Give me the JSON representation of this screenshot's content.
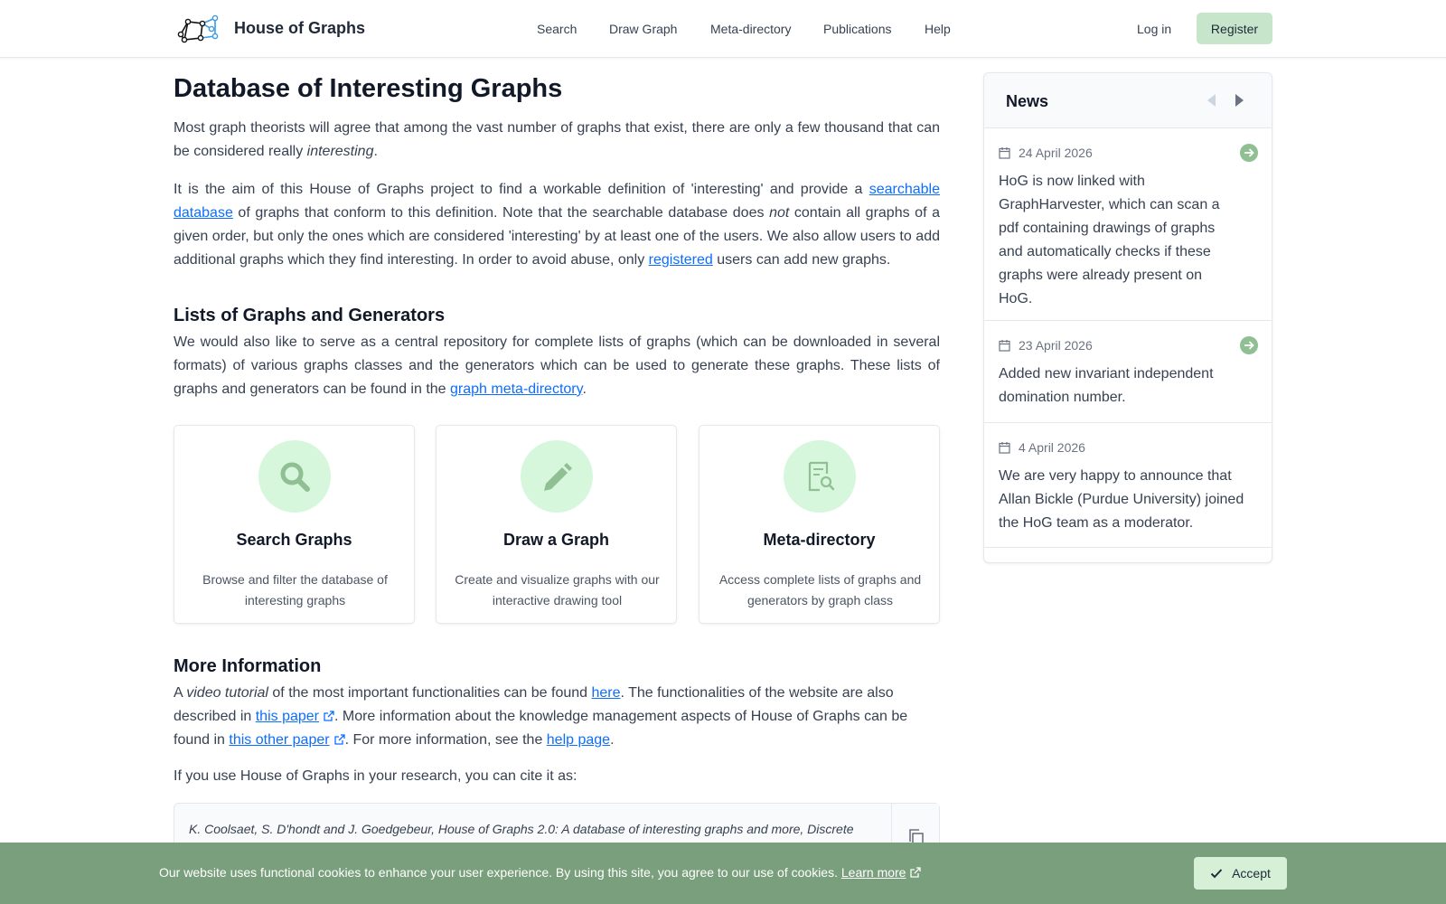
{
  "header": {
    "brand": "House of Graphs",
    "nav": [
      "Search",
      "Draw Graph",
      "Meta-directory",
      "Publications",
      "Help"
    ],
    "login": "Log in",
    "register": "Register"
  },
  "main": {
    "title": "Database of Interesting Graphs",
    "intro": {
      "p1_a": "Most graph theorists will agree that among the vast number of graphs that exist, there are only a few thousand that can be considered really ",
      "p1_em": "interesting",
      "p1_b": ".",
      "p2_a": "It is the aim of this House of Graphs project to find a workable definition of 'interesting' and provide a ",
      "p2_link": "searchable database",
      "p2_b": " of graphs that conform to this definition. Note that the searchable database does ",
      "p2_em": "not",
      "p2_c": " contain all graphs of a given order, but only the ones which are considered 'interesting' by at least one of the users. We also allow users to add additional graphs which they find interesting. In order to avoid abuse, only ",
      "p2_link2": "registered",
      "p2_d": " users can add new graphs."
    },
    "lists": {
      "heading": "Lists of Graphs and Generators",
      "p_a": "We would also like to serve as a central repository for complete lists of graphs (which can be downloaded in several formats) of various graphs classes and the generators which can be used to generate these graphs. These lists of graphs and generators can be found in the ",
      "p_link": "graph meta-directory",
      "p_b": "."
    },
    "cards": [
      {
        "icon": "search-icon",
        "title": "Search Graphs",
        "desc": "Browse and filter the database of interesting graphs"
      },
      {
        "icon": "pencil-icon",
        "title": "Draw a Graph",
        "desc": "Create and visualize graphs with our interactive drawing tool"
      },
      {
        "icon": "document-search-icon",
        "title": "Meta-directory",
        "desc": "Access complete lists of graphs and generators by graph class"
      }
    ],
    "more": {
      "heading": "More Information",
      "a": "A ",
      "em": "video tutorial",
      "b": " of the most important functionalities can be found ",
      "link_here": "here",
      "c": ". The functionalities of the website are also described in ",
      "link_paper": "this paper",
      "d": ". More information about the knowledge management aspects of House of Graphs can be found in ",
      "link_other": "this other paper",
      "e": ". For more information, see the ",
      "link_help": "help page",
      "f": "."
    },
    "cite_intro": "If you use House of Graphs in your research, you can cite it as:",
    "citation": "K. Coolsaet, S. D'hondt and J. Goedgebeur, House of Graphs 2.0: A database of interesting graphs and more, Discrete"
  },
  "news": {
    "title": "News",
    "items": [
      {
        "date": "24 April 2026",
        "text": "HoG is now linked with GraphHarvester, which can scan a pdf containing drawings of graphs and automatically checks if these graphs were already present on HoG."
      },
      {
        "date": "23 April 2026",
        "text": "Added new invariant independent domination number."
      },
      {
        "date": "4 April 2026",
        "text": "We are very happy to announce that Allan Bickle (Purdue University) joined the HoG team as a moderator."
      }
    ]
  },
  "cookie": {
    "text": "Our website uses functional cookies to enhance your user experience. By using this site, you agree to our use of cookies. ",
    "link": "Learn more",
    "accept": "Accept"
  },
  "colors": {
    "accent_green": "#7a9f7d",
    "card_circle": "#d6f7dc",
    "link_blue": "#0d6efd"
  }
}
